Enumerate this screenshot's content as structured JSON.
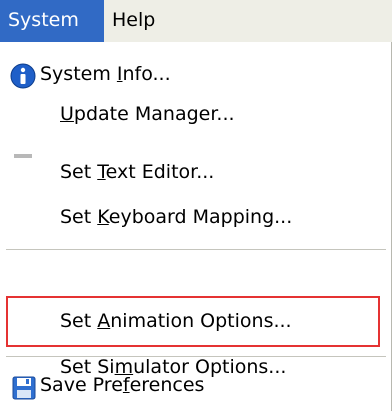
{
  "menubar": {
    "system_label": "System",
    "help_label": "Help"
  },
  "menu": {
    "items": [
      {
        "pre": "System ",
        "key": "I",
        "post": "nfo...",
        "icon": "info-icon"
      },
      {
        "pre": "",
        "key": "U",
        "post": "pdate Manager...",
        "icon": "update-icon"
      },
      {
        "pre": "Set ",
        "key": "T",
        "post": "ext Editor...",
        "icon": ""
      },
      {
        "pre": "Set ",
        "key": "K",
        "post": "eyboard Mapping...",
        "icon": ""
      },
      {
        "pre": "Set ",
        "key": "A",
        "post": "nimation Options...",
        "icon": ""
      },
      {
        "pre": "Set Si",
        "key": "m",
        "post": "ulator Options...",
        "icon": ""
      },
      {
        "pre": "Save Pre",
        "key": "f",
        "post": "erences",
        "icon": "floppy-disk-icon"
      }
    ],
    "highlighted_item": "Set Animation Options..."
  },
  "colors": {
    "menubar_bg": "#eeeee6",
    "selection_bg": "#316ac5",
    "highlight_border": "#e53232",
    "info_icon": "#1f5fc8"
  }
}
